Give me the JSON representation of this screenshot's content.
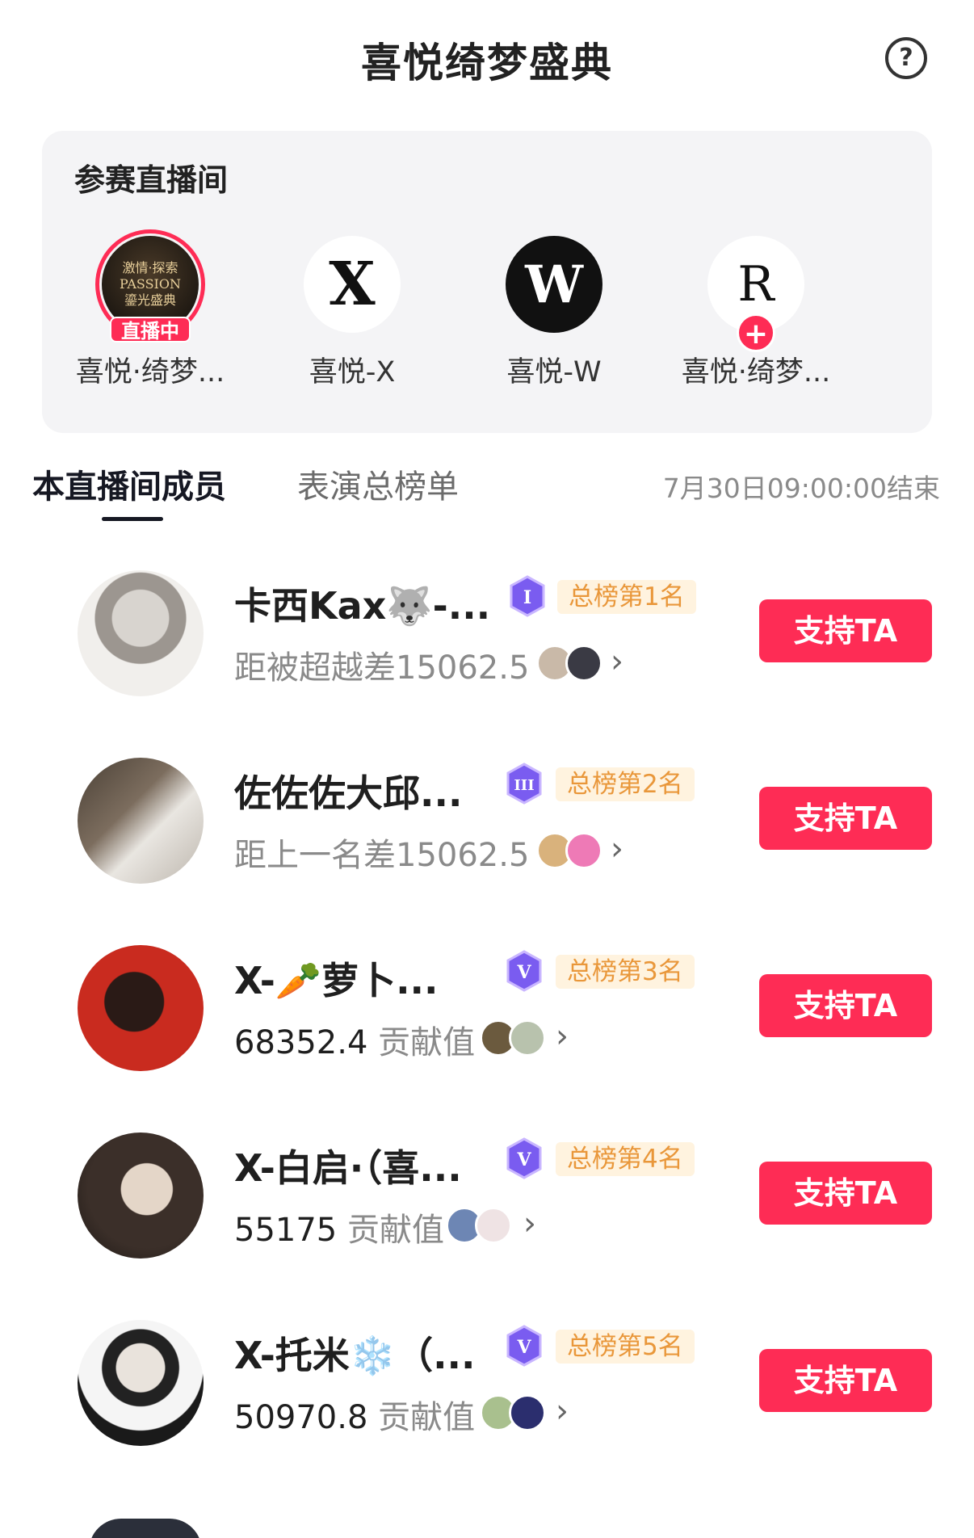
{
  "header": {
    "title": "喜悦绮梦盛典",
    "help_icon": "?"
  },
  "rooms": {
    "title": "参赛直播间",
    "items": [
      {
        "name": "喜悦·绮梦...",
        "badge": "直播中",
        "logo_text": "激情·探索 PASSION 鎏光盛典"
      },
      {
        "name": "喜悦-X",
        "logo_text": "X"
      },
      {
        "name": "喜悦-W",
        "logo_text": "W"
      },
      {
        "name": "喜悦·绮梦...",
        "badge": "+",
        "logo_text": "R"
      }
    ]
  },
  "tabs": {
    "active": "本直播间成员",
    "inactive": "表演总榜单",
    "end_time": "7月30日09:00:00结束"
  },
  "members": [
    {
      "name": "卡西Kax🐺-...",
      "rank": "总榜第1名",
      "level": "I",
      "prefix": "距被超越差",
      "value": "15062.5",
      "button": "支持TA"
    },
    {
      "name": "佐佐佐大邱...",
      "rank": "总榜第2名",
      "level": "III",
      "prefix": "距上一名差",
      "value": "15062.5",
      "button": "支持TA"
    },
    {
      "name": "X-🥕萝卜...",
      "rank": "总榜第3名",
      "level": "V",
      "value": "68352.4",
      "suffix": "贡献值",
      "button": "支持TA"
    },
    {
      "name": "X-白启·（喜...",
      "rank": "总榜第4名",
      "level": "V",
      "value": "55175",
      "suffix": "贡献值",
      "button": "支持TA"
    },
    {
      "name": "X-托米❄️（...",
      "rank": "总榜第5名",
      "level": "V",
      "value": "50970.8",
      "suffix": "贡献值",
      "button": "支持TA"
    }
  ],
  "colors": {
    "accent": "#fe2c55",
    "rank_bg": "#fff3df",
    "rank_text": "#e9973a",
    "level_badge": "#7a5cf0"
  }
}
